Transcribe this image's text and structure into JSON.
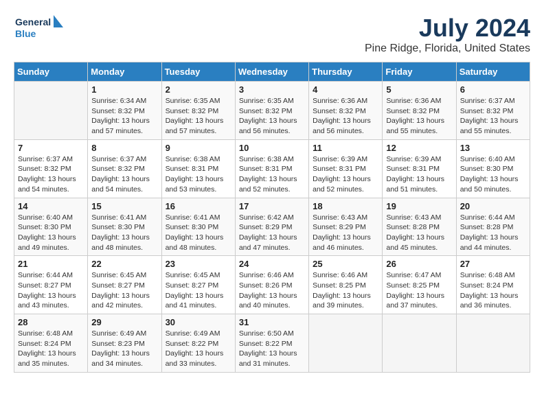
{
  "logo": {
    "line1": "General",
    "line2": "Blue"
  },
  "title": "July 2024",
  "subtitle": "Pine Ridge, Florida, United States",
  "days_header": [
    "Sunday",
    "Monday",
    "Tuesday",
    "Wednesday",
    "Thursday",
    "Friday",
    "Saturday"
  ],
  "weeks": [
    [
      {
        "day": "",
        "info": ""
      },
      {
        "day": "1",
        "info": "Sunrise: 6:34 AM\nSunset: 8:32 PM\nDaylight: 13 hours\nand 57 minutes."
      },
      {
        "day": "2",
        "info": "Sunrise: 6:35 AM\nSunset: 8:32 PM\nDaylight: 13 hours\nand 57 minutes."
      },
      {
        "day": "3",
        "info": "Sunrise: 6:35 AM\nSunset: 8:32 PM\nDaylight: 13 hours\nand 56 minutes."
      },
      {
        "day": "4",
        "info": "Sunrise: 6:36 AM\nSunset: 8:32 PM\nDaylight: 13 hours\nand 56 minutes."
      },
      {
        "day": "5",
        "info": "Sunrise: 6:36 AM\nSunset: 8:32 PM\nDaylight: 13 hours\nand 55 minutes."
      },
      {
        "day": "6",
        "info": "Sunrise: 6:37 AM\nSunset: 8:32 PM\nDaylight: 13 hours\nand 55 minutes."
      }
    ],
    [
      {
        "day": "7",
        "info": "Sunrise: 6:37 AM\nSunset: 8:32 PM\nDaylight: 13 hours\nand 54 minutes."
      },
      {
        "day": "8",
        "info": "Sunrise: 6:37 AM\nSunset: 8:32 PM\nDaylight: 13 hours\nand 54 minutes."
      },
      {
        "day": "9",
        "info": "Sunrise: 6:38 AM\nSunset: 8:31 PM\nDaylight: 13 hours\nand 53 minutes."
      },
      {
        "day": "10",
        "info": "Sunrise: 6:38 AM\nSunset: 8:31 PM\nDaylight: 13 hours\nand 52 minutes."
      },
      {
        "day": "11",
        "info": "Sunrise: 6:39 AM\nSunset: 8:31 PM\nDaylight: 13 hours\nand 52 minutes."
      },
      {
        "day": "12",
        "info": "Sunrise: 6:39 AM\nSunset: 8:31 PM\nDaylight: 13 hours\nand 51 minutes."
      },
      {
        "day": "13",
        "info": "Sunrise: 6:40 AM\nSunset: 8:30 PM\nDaylight: 13 hours\nand 50 minutes."
      }
    ],
    [
      {
        "day": "14",
        "info": "Sunrise: 6:40 AM\nSunset: 8:30 PM\nDaylight: 13 hours\nand 49 minutes."
      },
      {
        "day": "15",
        "info": "Sunrise: 6:41 AM\nSunset: 8:30 PM\nDaylight: 13 hours\nand 48 minutes."
      },
      {
        "day": "16",
        "info": "Sunrise: 6:41 AM\nSunset: 8:30 PM\nDaylight: 13 hours\nand 48 minutes."
      },
      {
        "day": "17",
        "info": "Sunrise: 6:42 AM\nSunset: 8:29 PM\nDaylight: 13 hours\nand 47 minutes."
      },
      {
        "day": "18",
        "info": "Sunrise: 6:43 AM\nSunset: 8:29 PM\nDaylight: 13 hours\nand 46 minutes."
      },
      {
        "day": "19",
        "info": "Sunrise: 6:43 AM\nSunset: 8:28 PM\nDaylight: 13 hours\nand 45 minutes."
      },
      {
        "day": "20",
        "info": "Sunrise: 6:44 AM\nSunset: 8:28 PM\nDaylight: 13 hours\nand 44 minutes."
      }
    ],
    [
      {
        "day": "21",
        "info": "Sunrise: 6:44 AM\nSunset: 8:27 PM\nDaylight: 13 hours\nand 43 minutes."
      },
      {
        "day": "22",
        "info": "Sunrise: 6:45 AM\nSunset: 8:27 PM\nDaylight: 13 hours\nand 42 minutes."
      },
      {
        "day": "23",
        "info": "Sunrise: 6:45 AM\nSunset: 8:27 PM\nDaylight: 13 hours\nand 41 minutes."
      },
      {
        "day": "24",
        "info": "Sunrise: 6:46 AM\nSunset: 8:26 PM\nDaylight: 13 hours\nand 40 minutes."
      },
      {
        "day": "25",
        "info": "Sunrise: 6:46 AM\nSunset: 8:25 PM\nDaylight: 13 hours\nand 39 minutes."
      },
      {
        "day": "26",
        "info": "Sunrise: 6:47 AM\nSunset: 8:25 PM\nDaylight: 13 hours\nand 37 minutes."
      },
      {
        "day": "27",
        "info": "Sunrise: 6:48 AM\nSunset: 8:24 PM\nDaylight: 13 hours\nand 36 minutes."
      }
    ],
    [
      {
        "day": "28",
        "info": "Sunrise: 6:48 AM\nSunset: 8:24 PM\nDaylight: 13 hours\nand 35 minutes."
      },
      {
        "day": "29",
        "info": "Sunrise: 6:49 AM\nSunset: 8:23 PM\nDaylight: 13 hours\nand 34 minutes."
      },
      {
        "day": "30",
        "info": "Sunrise: 6:49 AM\nSunset: 8:22 PM\nDaylight: 13 hours\nand 33 minutes."
      },
      {
        "day": "31",
        "info": "Sunrise: 6:50 AM\nSunset: 8:22 PM\nDaylight: 13 hours\nand 31 minutes."
      },
      {
        "day": "",
        "info": ""
      },
      {
        "day": "",
        "info": ""
      },
      {
        "day": "",
        "info": ""
      }
    ]
  ]
}
